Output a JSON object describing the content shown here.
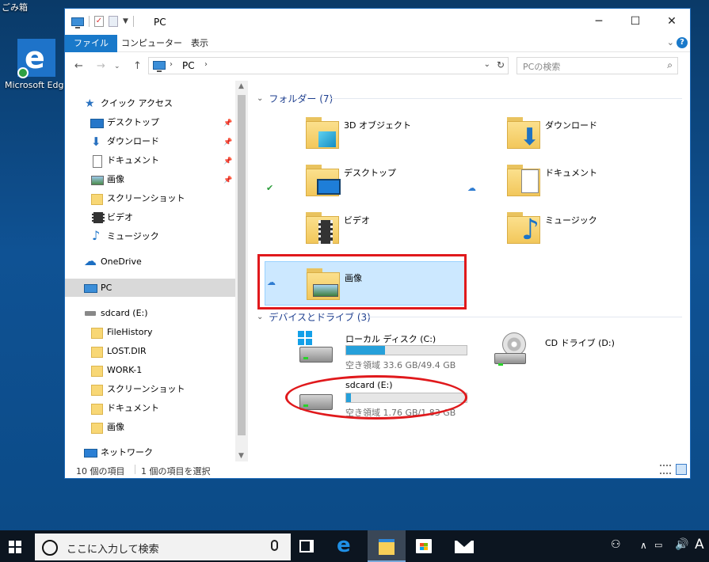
{
  "desktop": {
    "trash_label": "ごみ箱",
    "edge_label": "Microsoft Edge"
  },
  "window": {
    "title": "PC",
    "ribbon_tabs": [
      "ファイル",
      "コンピューター",
      "表示"
    ],
    "address": "PC",
    "search_placeholder": "PCの検索"
  },
  "nav": {
    "items": [
      {
        "label": "クイック アクセス",
        "icon": "star-icon"
      },
      {
        "label": "デスクトップ",
        "icon": "desktop-icon",
        "pinned": true
      },
      {
        "label": "ダウンロード",
        "icon": "download-icon",
        "pinned": true
      },
      {
        "label": "ドキュメント",
        "icon": "documents-icon",
        "pinned": true
      },
      {
        "label": "画像",
        "icon": "pictures-icon",
        "pinned": true
      },
      {
        "label": "スクリーンショット",
        "icon": "folder-icon"
      },
      {
        "label": "ビデオ",
        "icon": "video-icon"
      },
      {
        "label": "ミュージック",
        "icon": "music-icon"
      },
      {
        "label": "OneDrive",
        "icon": "onedrive-icon"
      },
      {
        "label": "PC",
        "icon": "pc-icon"
      },
      {
        "label": "sdcard (E:)",
        "icon": "drive-icon"
      },
      {
        "label": "FileHistory",
        "icon": "folder-icon"
      },
      {
        "label": "LOST.DIR",
        "icon": "folder-icon"
      },
      {
        "label": "WORK-1",
        "icon": "folder-icon"
      },
      {
        "label": "スクリーンショット",
        "icon": "folder-icon"
      },
      {
        "label": "ドキュメント",
        "icon": "folder-icon"
      },
      {
        "label": "画像",
        "icon": "folder-icon"
      },
      {
        "label": "ネットワーク",
        "icon": "network-icon"
      }
    ]
  },
  "content": {
    "folders_header": "フォルダー (7)",
    "folders": [
      {
        "label": "3D オブジェクト",
        "status": ""
      },
      {
        "label": "ダウンロード",
        "status": ""
      },
      {
        "label": "デスクトップ",
        "status": "synced"
      },
      {
        "label": "ドキュメント",
        "status": "cloud"
      },
      {
        "label": "ビデオ",
        "status": ""
      },
      {
        "label": "ミュージック",
        "status": ""
      },
      {
        "label": "画像",
        "status": "cloud",
        "selected": true
      }
    ],
    "drives_header": "デバイスとドライブ (3)",
    "drives": [
      {
        "name": "ローカル ディスク (C:)",
        "free": "空き領域 33.6 GB/49.4 GB",
        "used_fraction": 0.32
      },
      {
        "name": "CD ドライブ (D:)"
      },
      {
        "name": "sdcard (E:)",
        "free": "空き領域 1.76 GB/1.83 GB",
        "used_fraction": 0.04
      }
    ]
  },
  "statusbar": {
    "count": "10 個の項目",
    "selected": "1 個の項目を選択"
  },
  "taskbar": {
    "search_placeholder": "ここに入力して検索",
    "ime": "A"
  }
}
